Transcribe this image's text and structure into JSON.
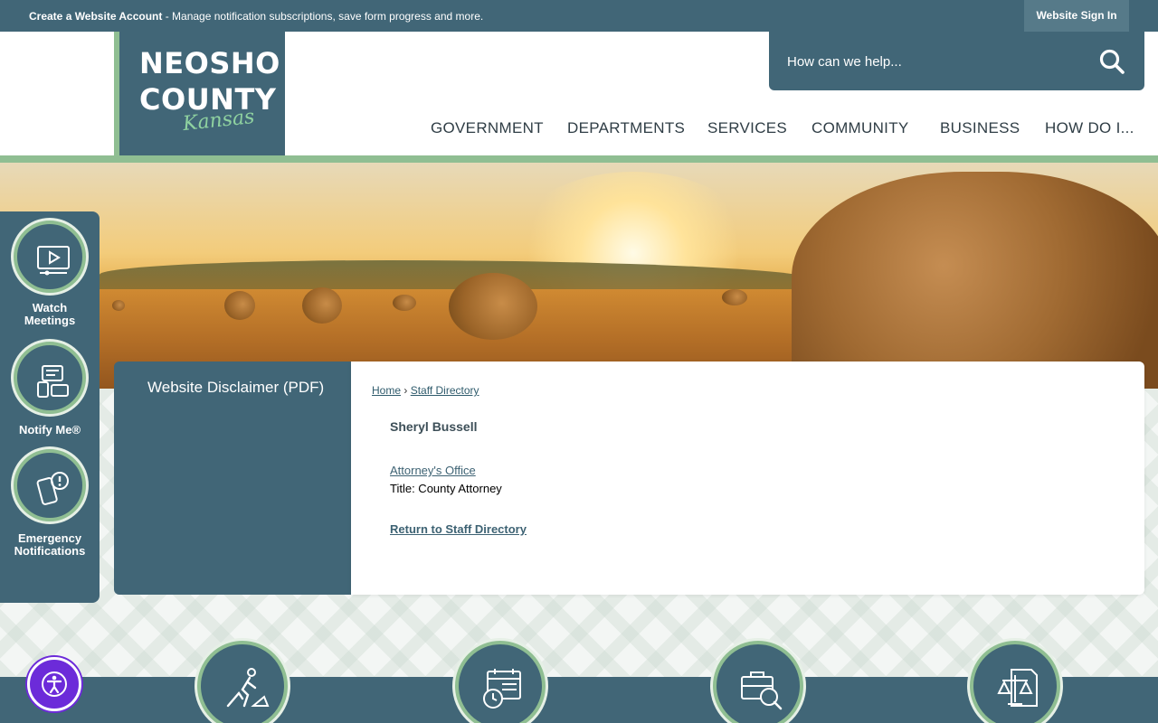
{
  "topbar": {
    "create_account": "Create a Website Account",
    "message": " - Manage notification subscriptions, save form progress and more.",
    "signin": "Website Sign In"
  },
  "logo": {
    "line1": "NEOSHO",
    "line2": "COUNTY",
    "line3": "Kansas"
  },
  "search": {
    "placeholder": "How can we help...",
    "icon": "search-icon"
  },
  "nav": [
    "GOVERNMENT",
    "DEPARTMENTS",
    "SERVICES",
    "COMMUNITY",
    "BUSINESS",
    "HOW DO I..."
  ],
  "quick_links": [
    {
      "label_1": "Watch",
      "label_2": "Meetings",
      "icon": "video-monitor-icon"
    },
    {
      "label": "Notify Me®",
      "icon": "notify-devices-icon"
    },
    {
      "label_1": "Emergency",
      "label_2": "Notifications",
      "icon": "phone-alert-icon"
    }
  ],
  "sidebar": {
    "link": "Website Disclaimer (PDF)"
  },
  "breadcrumb": {
    "home": "Home",
    "separator": "›",
    "current": "Staff Directory"
  },
  "staff": {
    "name": "Sheryl Bussell",
    "office": "Attorney's Office",
    "title": "Title: County Attorney",
    "return": "Return to Staff Directory"
  },
  "bottom_icons": [
    "road-work-icon",
    "calendar-clock-icon",
    "briefcase-search-icon",
    "justice-scales-icon"
  ],
  "accessibility": {
    "icon": "accessibility-icon"
  },
  "colors": {
    "primary": "#416677",
    "accent": "#8fbe92",
    "accessibility": "#6c2bd9"
  }
}
